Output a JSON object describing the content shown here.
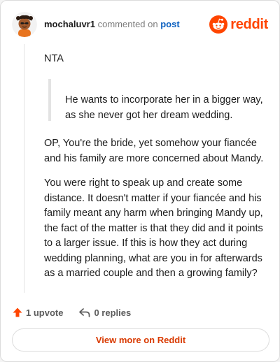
{
  "header": {
    "username": "mochaluvr1",
    "action_text": "commented on",
    "post_link": "post",
    "brand": "reddit"
  },
  "comment": {
    "paragraph1": "NTA",
    "quote": "He wants to incorporate her in a bigger way, as she never got her dream wedding.",
    "paragraph2": "OP, You're the bride, yet somehow your fiancée and his family are more concerned about Mandy.",
    "paragraph3": "You were right to speak up and create some distance. It doesn't matter if your fiancée and his family meant any harm when bringing Mandy up, the fact of the matter is that they did and it points to a larger issue. If this is how they act during wedding planning, what are you in for afterwards as a married couple and then a growing family?"
  },
  "actions": {
    "upvote_label": "1 upvote",
    "replies_label": "0 replies"
  },
  "footer": {
    "view_more_label": "View more on Reddit"
  },
  "colors": {
    "brand": "#ff4500",
    "link": "#0a5fbf",
    "view_more": "#d93a00"
  },
  "icons": [
    "avatar",
    "reddit-logo-icon",
    "upvote-arrow-icon",
    "reply-icon"
  ]
}
